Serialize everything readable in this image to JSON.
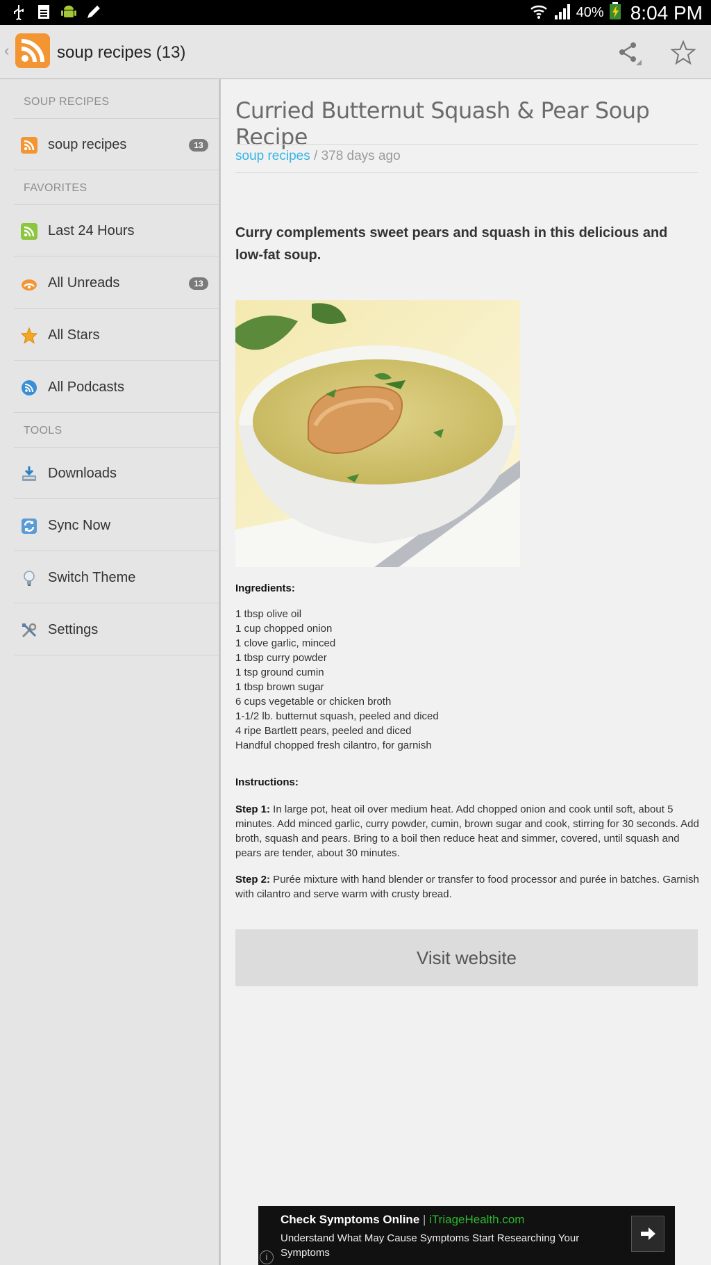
{
  "status_bar": {
    "battery_percent": "40%",
    "time": "8:04 PM",
    "icons": [
      "usb-icon",
      "sim-icon",
      "android-icon",
      "pencil-icon",
      "wifi-icon",
      "signal-icon",
      "battery-icon"
    ]
  },
  "action_bar": {
    "title": "soup recipes (13)",
    "icons": [
      "back-chevron-icon",
      "rss-logo-icon",
      "share-icon",
      "star-outline-icon"
    ],
    "accent_color": "#f39533"
  },
  "sidebar": {
    "sections": [
      {
        "header": "SOUP RECIPES",
        "items": [
          {
            "label": "soup recipes",
            "badge": "13",
            "icon": "rss-icon"
          }
        ]
      },
      {
        "header": "FAVORITES",
        "items": [
          {
            "label": "Last 24 Hours",
            "icon": "rss-green-icon"
          },
          {
            "label": "All Unreads",
            "badge": "13",
            "icon": "unread-feed-icon"
          },
          {
            "label": "All Stars",
            "icon": "star-icon"
          },
          {
            "label": "All Podcasts",
            "icon": "podcast-icon"
          }
        ]
      },
      {
        "header": "TOOLS",
        "items": [
          {
            "label": "Downloads",
            "icon": "download-icon"
          },
          {
            "label": "Sync Now",
            "icon": "sync-icon"
          },
          {
            "label": "Switch Theme",
            "icon": "lightbulb-icon"
          },
          {
            "label": "Settings",
            "icon": "tools-icon"
          }
        ]
      }
    ]
  },
  "article": {
    "title": "Curried Butternut Squash & Pear Soup Recipe",
    "source": "soup recipes",
    "meta_suffix": " / 378 days ago",
    "source_color": "#33b5e5",
    "lead": "Curry complements sweet pears and squash in this delicious and low-fat soup.",
    "ingredients_heading": "Ingredients:",
    "ingredients": [
      "1 tbsp olive oil",
      "1 cup chopped onion",
      "1 clove garlic, minced",
      "1 tbsp curry powder",
      "1 tsp ground cumin",
      "1 tbsp brown sugar",
      "6 cups vegetable or chicken broth",
      "1-1/2 lb. butternut squash, peeled and diced",
      "4 ripe Bartlett pears, peeled and diced",
      "Handful chopped fresh cilantro, for garnish"
    ],
    "instructions_heading": "Instructions:",
    "steps": [
      {
        "label": "Step 1:",
        "text": " In large pot, heat oil over medium heat. Add chopped onion and cook until soft, about 5 minutes. Add minced garlic, curry powder, cumin, brown sugar and cook, stirring for 30 seconds. Add broth, squash and pears. Bring to a boil then reduce heat and simmer, covered, until squash and pears are tender, about 30 minutes."
      },
      {
        "label": "Step 2:",
        "text": " Purée mixture with hand blender or transfer to food processor and purée in batches. Garnish with cilantro and serve warm with crusty bread."
      }
    ],
    "visit_button": "Visit website"
  },
  "ad": {
    "title": "Check Symptoms Online",
    "separator": " | ",
    "url": "iTriageHealth.com",
    "url_color": "#2eb82e",
    "body": "Understand What May Cause Symptoms Start Researching Your Symptoms",
    "icons": [
      "arrow-right-icon",
      "info-icon"
    ]
  }
}
